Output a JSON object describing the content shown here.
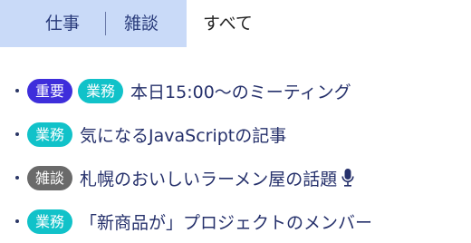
{
  "tabs": {
    "items": [
      "仕事",
      "雑談",
      "すべて"
    ]
  },
  "list": {
    "items": [
      {
        "tags": [
          "重要",
          "業務"
        ],
        "title": "本日15:00〜のミーティング"
      },
      {
        "tags": [
          "業務"
        ],
        "title": "気になるJavaScriptの記事"
      },
      {
        "tags": [
          "雑談"
        ],
        "title": "札幌のおいしいラーメン屋の話題"
      },
      {
        "tags": [
          "業務"
        ],
        "title": "「新商品が」プロジェクトのメンバー"
      }
    ]
  },
  "colors": {
    "tab_selected_bg": "#c9daf8",
    "tag_important": "#3e2edb",
    "tag_business": "#11c2c9",
    "tag_chat": "#6a6a6a"
  },
  "icons": {
    "mic": "microphone-icon"
  }
}
